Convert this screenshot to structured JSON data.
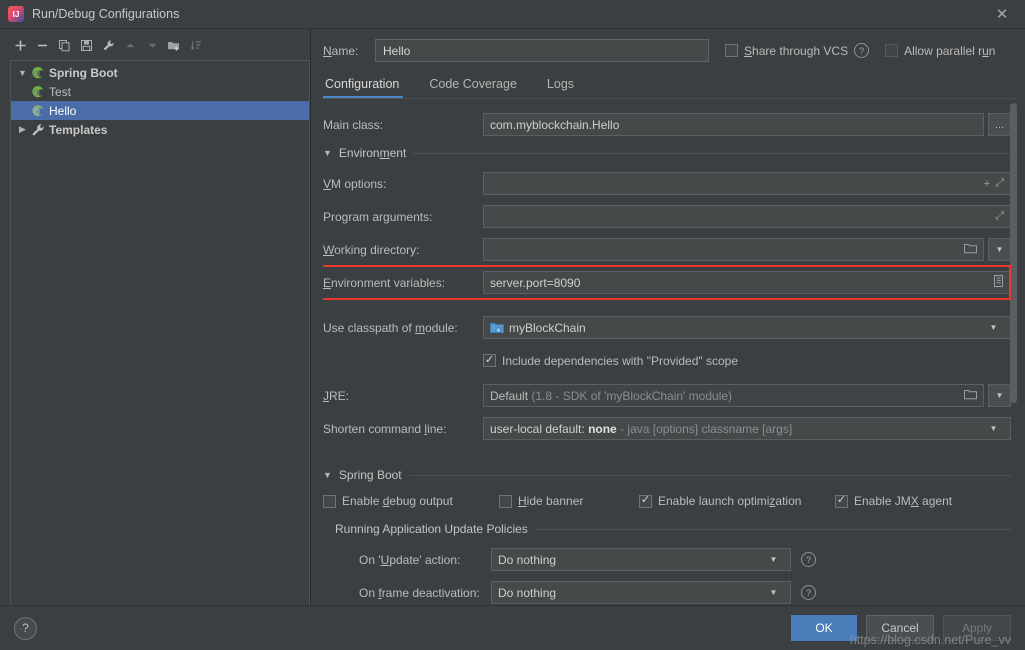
{
  "window": {
    "title": "Run/Debug Configurations",
    "app_icon": "intellij-idea-icon",
    "close_icon": "✕"
  },
  "toolbar": {
    "items": [
      {
        "name": "add-configuration-button",
        "icon": "plus-icon",
        "enabled": true
      },
      {
        "name": "remove-configuration-button",
        "icon": "minus-icon",
        "enabled": true
      },
      {
        "name": "copy-configuration-button",
        "icon": "copy-icon",
        "enabled": true
      },
      {
        "name": "save-configuration-button",
        "icon": "save-icon",
        "enabled": true
      },
      {
        "name": "edit-templates-button",
        "icon": "wrench-icon",
        "enabled": true
      },
      {
        "name": "move-up-button",
        "icon": "arrow-up-icon",
        "enabled": false
      },
      {
        "name": "move-down-button",
        "icon": "arrow-down-icon",
        "enabled": false
      },
      {
        "name": "create-folder-button",
        "icon": "folder-add-icon",
        "enabled": true
      },
      {
        "name": "sort-configurations-button",
        "icon": "sort-icon",
        "enabled": false
      }
    ]
  },
  "tree": {
    "nodes": [
      {
        "label": "Spring Boot",
        "icon": "spring-boot-icon",
        "level": 0,
        "expanded": true,
        "bold": true,
        "selected": false
      },
      {
        "label": "Test",
        "icon": "spring-boot-icon",
        "level": 1,
        "expanded": null,
        "bold": false,
        "selected": false
      },
      {
        "label": "Hello",
        "icon": "spring-boot-icon",
        "level": 1,
        "expanded": null,
        "bold": false,
        "selected": true
      },
      {
        "label": "Templates",
        "icon": "wrench-icon",
        "level": 0,
        "expanded": false,
        "bold": true,
        "selected": false
      }
    ]
  },
  "header": {
    "name_label": "Name:",
    "name_value": "Hello",
    "share_through_vcs_label": "Share through VCS",
    "share_through_vcs_checked": false,
    "share_help_icon": "?",
    "allow_parallel_run_label": "Allow parallel run",
    "allow_parallel_run_checked": false
  },
  "tabs": [
    {
      "label": "Configuration",
      "active": true
    },
    {
      "label": "Code Coverage",
      "active": false
    },
    {
      "label": "Logs",
      "active": false
    }
  ],
  "form": {
    "main_class": {
      "label": "Main class:",
      "value": "com.myblockchain.Hello",
      "browse_button": "..."
    },
    "environment_section": {
      "title": "Environment",
      "expanded": true
    },
    "vm_options": {
      "label": "VM options:",
      "value": "",
      "icons": [
        "plus-icon",
        "expand-icon"
      ]
    },
    "program_arguments": {
      "label": "Program arguments:",
      "value": "",
      "icons": [
        "expand-icon"
      ]
    },
    "working_directory": {
      "label": "Working directory:",
      "value": "",
      "icons": [
        "folder-icon",
        "chevron-down-icon"
      ]
    },
    "environment_variables": {
      "label": "Environment variables:",
      "value": "server.port=8090",
      "icons": [
        "browse-list-icon"
      ],
      "highlighted": true,
      "highlight_color": "#e8372c"
    },
    "use_classpath_of_module": {
      "label": "Use classpath of module:",
      "value": "myBlockChain",
      "icon": "module-icon"
    },
    "include_provided_scope": {
      "label": "Include dependencies with \"Provided\" scope",
      "checked": true
    },
    "jre": {
      "label": "JRE:",
      "value": "Default",
      "hint": "(1.8 - SDK of 'myBlockChain' module)",
      "icons": [
        "folder-icon",
        "chevron-down-icon"
      ]
    },
    "shorten_command_line": {
      "label": "Shorten command line:",
      "value_prefix": "user-local default: ",
      "value_strong": "none",
      "value_hint": " - java [options] classname [args]"
    },
    "spring_boot_section": {
      "title": "Spring Boot",
      "expanded": true,
      "checks": [
        {
          "label": "Enable debug output",
          "checked": false
        },
        {
          "label": "Hide banner",
          "checked": false
        },
        {
          "label": "Enable launch optimization",
          "checked": true
        },
        {
          "label": "Enable JMX agent",
          "checked": true
        }
      ]
    },
    "update_policies_section": {
      "title": "Running Application Update Policies"
    },
    "on_update_action": {
      "label": "On 'Update' action:",
      "value": "Do nothing",
      "help_icon": "?"
    },
    "on_frame_deactivation": {
      "label": "On frame deactivation:",
      "value": "Do nothing",
      "help_icon": "?"
    }
  },
  "footer": {
    "help_button": "?",
    "ok_label": "OK",
    "cancel_label": "Cancel",
    "apply_label": "Apply",
    "apply_enabled": false,
    "watermark": "https://blog.csdn.net/Pure_vv"
  },
  "colors": {
    "background": "#3c3f41",
    "selection_blue": "#4a6da7",
    "accent_blue": "#4a88c7",
    "primary_button": "#4a7ebb",
    "annotation_red": "#e8372c"
  }
}
